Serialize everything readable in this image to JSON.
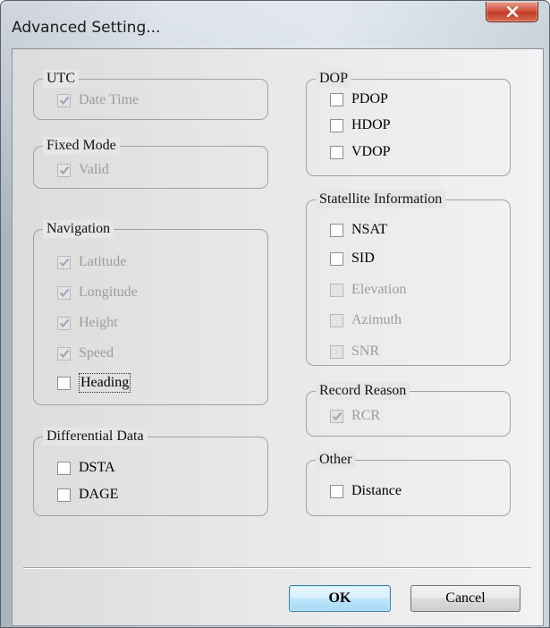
{
  "window": {
    "title": "Advanced Setting..."
  },
  "groups": {
    "utc": {
      "label": "UTC",
      "items": [
        {
          "label": "Date Time",
          "checked": true,
          "enabled": false
        }
      ]
    },
    "fixed_mode": {
      "label": "Fixed Mode",
      "items": [
        {
          "label": "Valid",
          "checked": true,
          "enabled": false
        }
      ]
    },
    "navigation": {
      "label": "Navigation",
      "items": [
        {
          "label": "Latitude",
          "checked": true,
          "enabled": false
        },
        {
          "label": "Longitude",
          "checked": true,
          "enabled": false
        },
        {
          "label": "Height",
          "checked": true,
          "enabled": false
        },
        {
          "label": "Speed",
          "checked": true,
          "enabled": false
        },
        {
          "label": "Heading",
          "checked": false,
          "enabled": true,
          "focused": true
        }
      ]
    },
    "differential": {
      "label": "Differential Data",
      "items": [
        {
          "label": "DSTA",
          "checked": false,
          "enabled": true
        },
        {
          "label": "DAGE",
          "checked": false,
          "enabled": true
        }
      ]
    },
    "dop": {
      "label": "DOP",
      "items": [
        {
          "label": "PDOP",
          "checked": false,
          "enabled": true
        },
        {
          "label": "HDOP",
          "checked": false,
          "enabled": true
        },
        {
          "label": "VDOP",
          "checked": false,
          "enabled": true
        }
      ]
    },
    "satellite": {
      "label": "Statellite Information",
      "items": [
        {
          "label": "NSAT",
          "checked": false,
          "enabled": true
        },
        {
          "label": "SID",
          "checked": false,
          "enabled": true
        },
        {
          "label": "Elevation",
          "checked": false,
          "enabled": false
        },
        {
          "label": "Azimuth",
          "checked": false,
          "enabled": false
        },
        {
          "label": "SNR",
          "checked": false,
          "enabled": false
        }
      ]
    },
    "record_reason": {
      "label": "Record Reason",
      "items": [
        {
          "label": "RCR",
          "checked": true,
          "enabled": false
        }
      ]
    },
    "other": {
      "label": "Other",
      "items": [
        {
          "label": "Distance",
          "checked": false,
          "enabled": true
        }
      ]
    }
  },
  "buttons": {
    "ok": "OK",
    "cancel": "Cancel"
  },
  "icons": {
    "close": "close-icon",
    "check": "checkmark-icon"
  }
}
